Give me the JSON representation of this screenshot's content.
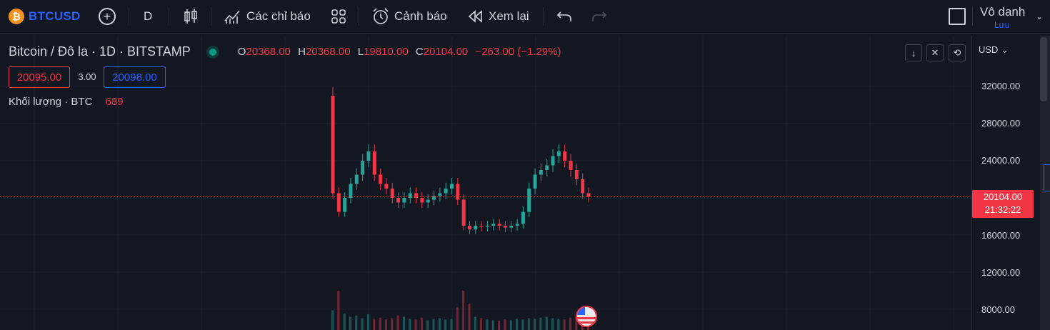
{
  "toolbar": {
    "symbol": "BTCUSD",
    "coin_glyph": "₿",
    "interval": "D",
    "indicators_label": "Các chỉ báo",
    "alerts_label": "Cảnh báo",
    "replay_label": "Xem lại",
    "user_name": "Vô danh",
    "save_label": "Lưu"
  },
  "legend": {
    "title": "Bitcoin / Đô la · 1D · BITSTAMP",
    "open_label": "O",
    "open": "20368.00",
    "high_label": "H",
    "high": "20368.00",
    "low_label": "L",
    "low": "19810.00",
    "close_label": "C",
    "close": "20104.00",
    "change": "−263.00 (−1.29%)",
    "bid": "20095.00",
    "spread": "3.00",
    "ask": "20098.00",
    "volume_label": "Khối lượng · BTC",
    "volume_value": "689"
  },
  "scale": {
    "currency": "USD",
    "ticks": [
      "32000.00",
      "28000.00",
      "24000.00",
      "16000.00",
      "12000.00",
      "8000.00"
    ],
    "last_price": "20104.00",
    "countdown": "21:32:22"
  },
  "colors": {
    "background": "#131722",
    "up": "#26a69a",
    "down": "#f23645",
    "accent": "#2962ff"
  },
  "chart_data": {
    "type": "candlestick",
    "ylim": [
      6500,
      35000
    ],
    "last_price": 20104,
    "series": [
      {
        "values": [
          20500,
          18500,
          20000,
          21500,
          22500,
          24000,
          25000,
          22500,
          21500,
          21000,
          20000,
          19500,
          20000,
          20500,
          20000,
          19500,
          19800,
          20200,
          20500,
          21000,
          21500,
          19800,
          17000,
          16600,
          17000,
          16900,
          17000,
          17200,
          17000,
          16800,
          17000,
          17200,
          18500,
          21000,
          22500,
          23000,
          23500,
          24500,
          25000,
          24000,
          23000,
          22000,
          20500,
          20104
        ]
      }
    ],
    "volume_series": [
      {
        "values": [
          3000,
          6000,
          2500,
          2000,
          2200,
          1800,
          2400,
          1700,
          1900,
          1600,
          1800,
          2200,
          2000,
          1700,
          1600,
          1900,
          1500,
          1700,
          1800,
          1600,
          1700,
          3500,
          6000,
          4000,
          2000,
          1800,
          1600,
          1500,
          1400,
          1600,
          1500,
          1700,
          1600,
          1800,
          1700,
          1900,
          2000,
          1800,
          1700,
          1600,
          1900,
          2100,
          2500,
          689
        ]
      }
    ]
  }
}
